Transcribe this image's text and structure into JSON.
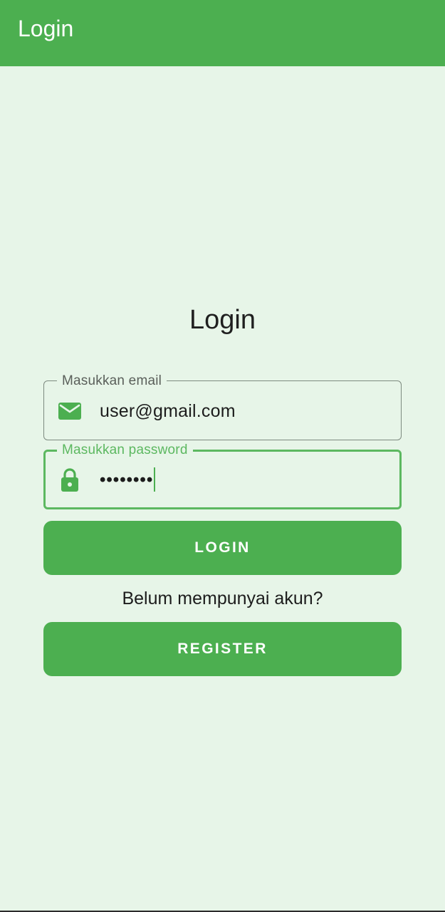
{
  "app_bar": {
    "title": "Login"
  },
  "form": {
    "title": "Login",
    "email_field": {
      "label": "Masukkan email",
      "value": "user@gmail.com",
      "icon": "email-icon"
    },
    "password_field": {
      "label": "Masukkan password",
      "value": "••••••••",
      "icon": "lock-icon"
    },
    "login_button_label": "LOGIN",
    "register_prompt": "Belum mempunyai akun?",
    "register_button_label": "REGISTER"
  },
  "colors": {
    "primary": "#4caf50",
    "background": "#e7f5e8",
    "focused_border": "#5cb860"
  }
}
